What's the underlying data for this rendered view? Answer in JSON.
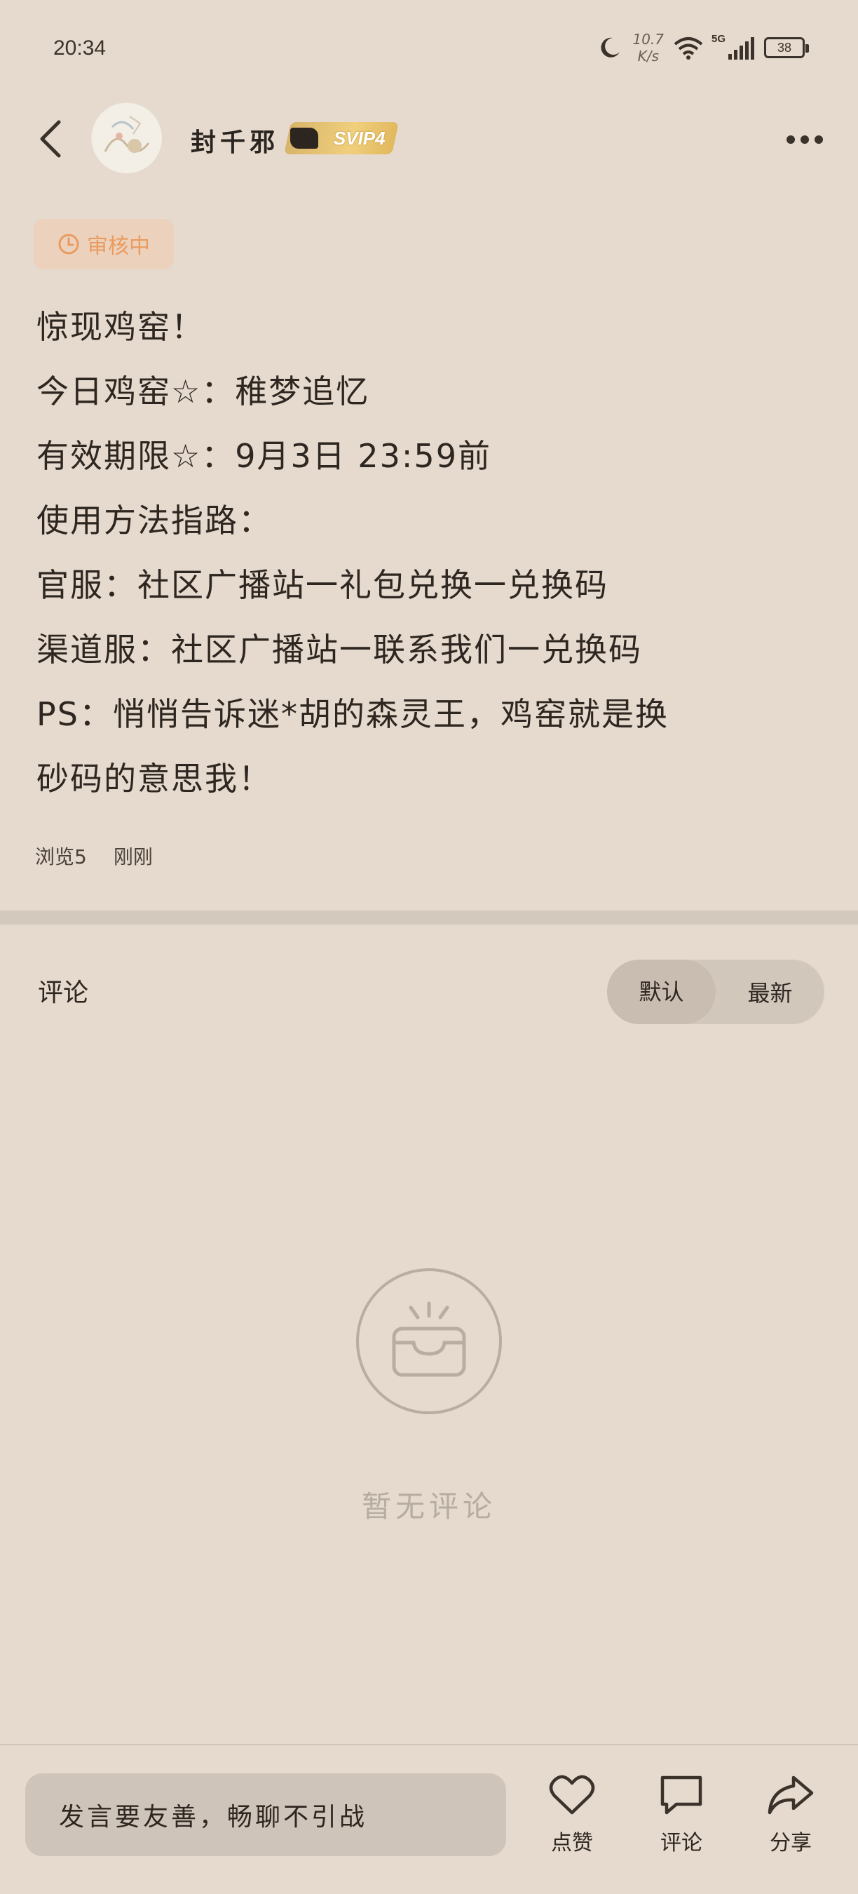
{
  "status_bar": {
    "time": "20:34",
    "net_speed_value": "10.7",
    "net_speed_unit": "K/s",
    "network": "5G",
    "battery": "38"
  },
  "header": {
    "username": "封千邪",
    "vip_label": "SVIP4"
  },
  "post": {
    "review_status": "审核中",
    "lines": [
      "惊现鸡窑！",
      "今日鸡窑☆：稚梦追忆",
      "有效期限☆：9月3日 23:59前",
      "使用方法指路：",
      "官服：社区广播站一礼包兑换一兑换码",
      "渠道服：社区广播站一联系我们一兑换码",
      "PS：悄悄告诉迷*胡的森灵王，鸡窑就是换",
      "砂码的意思我！"
    ],
    "views": "浏览5",
    "time": "刚刚"
  },
  "comments": {
    "title": "评论",
    "sort_default": "默认",
    "sort_latest": "最新",
    "empty_text": "暂无评论"
  },
  "bottom_bar": {
    "input_placeholder": "发言要友善，畅聊不引战",
    "like_label": "点赞",
    "comment_label": "评论",
    "share_label": "分享"
  }
}
